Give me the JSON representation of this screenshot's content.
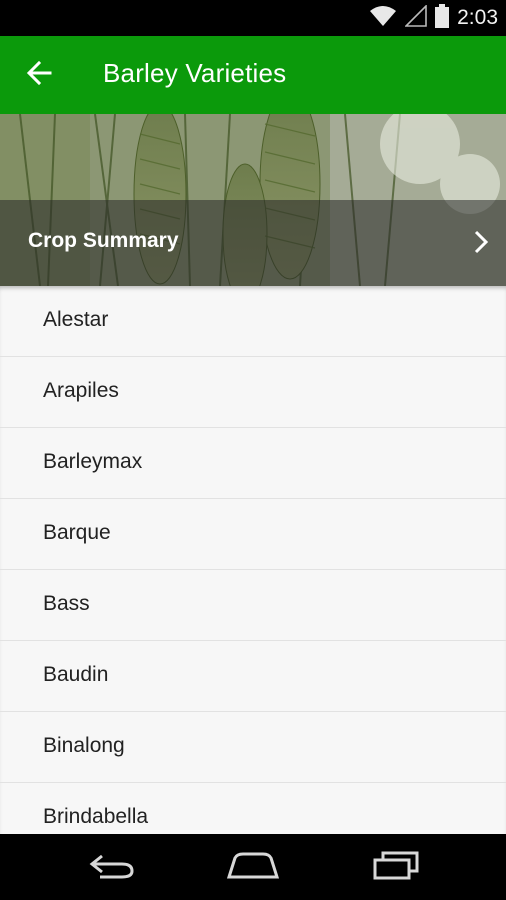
{
  "status_bar": {
    "time": "2:03",
    "icons": [
      "wifi-icon",
      "cell-signal-icon",
      "battery-icon"
    ]
  },
  "app_bar": {
    "title": "Barley Varieties",
    "back_icon": "arrow-back-icon",
    "color": "#0b9a0b"
  },
  "hero": {
    "summary_label": "Crop Summary",
    "chevron_icon": "chevron-right-icon"
  },
  "varieties": [
    {
      "label": "Alestar"
    },
    {
      "label": "Arapiles"
    },
    {
      "label": "Barleymax"
    },
    {
      "label": "Barque"
    },
    {
      "label": "Bass"
    },
    {
      "label": "Baudin"
    },
    {
      "label": "Binalong"
    },
    {
      "label": "Brindabella"
    }
  ],
  "nav_bar": {
    "buttons": [
      "back-nav-icon",
      "home-nav-icon",
      "recents-nav-icon"
    ]
  }
}
